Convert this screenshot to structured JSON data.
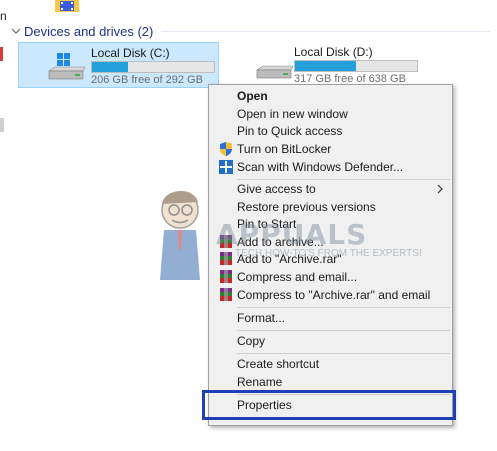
{
  "left_letter": "n",
  "section": {
    "title": "Devices and drives (2)"
  },
  "drives": [
    {
      "name": "Local Disk (C:)",
      "free_text": "206 GB free of 292 GB",
      "used_fraction": 0.295,
      "selected": true
    },
    {
      "name": "Local Disk (D:)",
      "free_text": "317 GB free of 638 GB",
      "used_fraction": 0.503,
      "selected": false
    }
  ],
  "context_menu": {
    "items": [
      {
        "label": "Open",
        "bold": true,
        "icon": ""
      },
      {
        "label": "Open in new window",
        "icon": ""
      },
      {
        "label": "Pin to Quick access",
        "icon": ""
      },
      {
        "label": "Turn on BitLocker",
        "icon": "shield-icon"
      },
      {
        "label": "Scan with Windows Defender...",
        "icon": "defender-icon"
      },
      {
        "label": "Give access to",
        "icon": "",
        "submenu": true
      },
      {
        "label": "Restore previous versions",
        "icon": ""
      },
      {
        "label": "Pin to Start",
        "icon": ""
      },
      {
        "label": "Add to archive...",
        "icon": "winrar-icon"
      },
      {
        "label": "Add to \"Archive.rar\"",
        "icon": "winrar-icon"
      },
      {
        "label": "Compress and email...",
        "icon": "winrar-icon"
      },
      {
        "label": "Compress to \"Archive.rar\" and email",
        "icon": "winrar-icon"
      },
      {
        "label": "Format...",
        "icon": ""
      },
      {
        "label": "Copy",
        "icon": ""
      },
      {
        "label": "Create shortcut",
        "icon": ""
      },
      {
        "label": "Rename",
        "icon": ""
      },
      {
        "label": "Properties",
        "icon": ""
      }
    ]
  },
  "watermark": {
    "title": "APPUALS",
    "tagline": "TECH HOW-TO'S FROM THE EXPERTS!"
  },
  "colors": {
    "accent": "#26a0da",
    "selection": "#cce8ff",
    "highlight_box": "#1f3fb5",
    "header": "#1e3287"
  }
}
